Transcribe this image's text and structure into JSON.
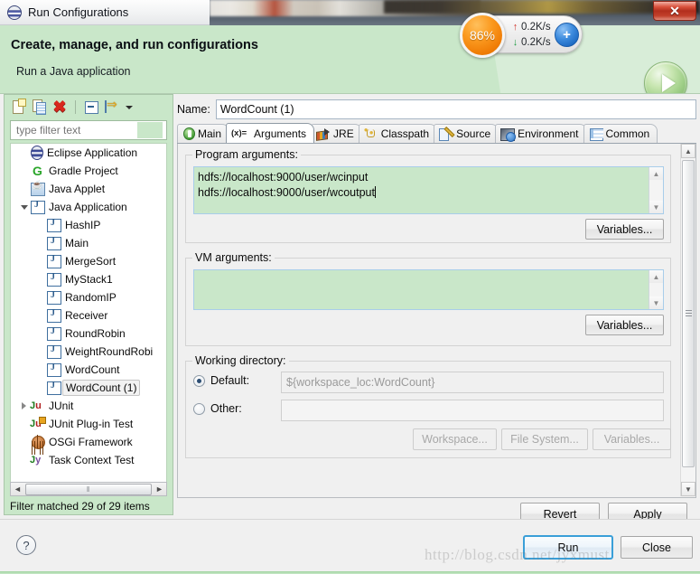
{
  "window": {
    "title": "Run Configurations",
    "close_label": "✕"
  },
  "header": {
    "title": "Create, manage, and run configurations",
    "subtitle": "Run a Java application"
  },
  "net_widget": {
    "cpu_percent": "86%",
    "upload_speed": "0.2K/s",
    "download_speed": "0.2K/s",
    "up_arrow": "↑",
    "down_arrow": "↓",
    "plus_label": "+"
  },
  "sidebar": {
    "toolbar": [
      {
        "name": "new-launch-configuration-icon",
        "label": ""
      },
      {
        "name": "duplicate-icon",
        "label": ""
      },
      {
        "name": "delete-icon",
        "label": "✖"
      },
      {
        "name": "collapse-all-icon",
        "label": ""
      },
      {
        "name": "filter-icon",
        "label": ""
      },
      {
        "name": "view-menu-caret-icon",
        "label": ""
      }
    ],
    "filter": {
      "value": "",
      "placeholder": "type filter text"
    },
    "tree": [
      {
        "label": "Eclipse Application",
        "icon": "eclipse",
        "depth": 1,
        "twisty": "none",
        "selected": false
      },
      {
        "label": "Gradle Project",
        "icon": "gradle",
        "depth": 1,
        "twisty": "none",
        "selected": false
      },
      {
        "label": "Java Applet",
        "icon": "applet",
        "depth": 1,
        "twisty": "none",
        "selected": false
      },
      {
        "label": "Java Application",
        "icon": "java",
        "depth": 1,
        "twisty": "open",
        "selected": false
      },
      {
        "label": "HashIP",
        "icon": "java",
        "depth": 2,
        "twisty": "none",
        "selected": false
      },
      {
        "label": "Main",
        "icon": "java",
        "depth": 2,
        "twisty": "none",
        "selected": false
      },
      {
        "label": "MergeSort",
        "icon": "java",
        "depth": 2,
        "twisty": "none",
        "selected": false
      },
      {
        "label": "MyStack1",
        "icon": "java",
        "depth": 2,
        "twisty": "none",
        "selected": false
      },
      {
        "label": "RandomIP",
        "icon": "java",
        "depth": 2,
        "twisty": "none",
        "selected": false
      },
      {
        "label": "Receiver",
        "icon": "java",
        "depth": 2,
        "twisty": "none",
        "selected": false
      },
      {
        "label": "RoundRobin",
        "icon": "java",
        "depth": 2,
        "twisty": "none",
        "selected": false
      },
      {
        "label": "WeightRoundRobi",
        "icon": "java",
        "depth": 2,
        "twisty": "none",
        "selected": false
      },
      {
        "label": "WordCount",
        "icon": "java",
        "depth": 2,
        "twisty": "none",
        "selected": false
      },
      {
        "label": "WordCount (1)",
        "icon": "java",
        "depth": 2,
        "twisty": "none",
        "selected": true
      },
      {
        "label": "JUnit",
        "icon": "junit",
        "depth": 1,
        "twisty": "closed",
        "selected": false
      },
      {
        "label": "JUnit Plug-in Test",
        "icon": "junitp",
        "depth": 1,
        "twisty": "none",
        "selected": false
      },
      {
        "label": "OSGi Framework",
        "icon": "osgi",
        "depth": 1,
        "twisty": "none",
        "selected": false
      },
      {
        "label": "Task Context Test",
        "icon": "task",
        "depth": 1,
        "twisty": "none",
        "selected": false
      }
    ],
    "hscroll": {
      "left_arrow": "◄",
      "right_arrow": "►",
      "grip": "‖"
    },
    "status": "Filter matched 29 of 29 items"
  },
  "config": {
    "name_label": "Name:",
    "name_value": "WordCount (1)",
    "tabs": [
      {
        "label": "Main",
        "icon": "main",
        "active": false
      },
      {
        "label": "Arguments",
        "icon": "args",
        "active": true
      },
      {
        "label": "JRE",
        "icon": "jre",
        "active": false
      },
      {
        "label": "Classpath",
        "icon": "cp",
        "active": false
      },
      {
        "label": "Source",
        "icon": "src",
        "active": false
      },
      {
        "label": "Environment",
        "icon": "env",
        "active": false
      },
      {
        "label": "Common",
        "icon": "com",
        "active": false
      }
    ],
    "program_arguments": {
      "group_label": "Program arguments:",
      "value_line1": "hdfs://localhost:9000/user/wcinput",
      "value_line2": "hdfs://localhost:9000/user/wcoutput",
      "variables_button": "Variables..."
    },
    "vm_arguments": {
      "group_label": "VM arguments:",
      "value": "",
      "variables_button": "Variables..."
    },
    "working_directory": {
      "group_label": "Working directory:",
      "default_label": "Default:",
      "default_value": "${workspace_loc:WordCount}",
      "default_selected": true,
      "other_label": "Other:",
      "other_value": "",
      "other_selected": false,
      "workspace_button": "Workspace...",
      "filesystem_button": "File System...",
      "variables_button": "Variables..."
    },
    "revert_button": "Revert",
    "apply_button": "Apply"
  },
  "footer": {
    "help_label": "?",
    "run_button": "Run",
    "close_button": "Close",
    "watermark": "http://blog.csdn.net/jyxmust"
  }
}
